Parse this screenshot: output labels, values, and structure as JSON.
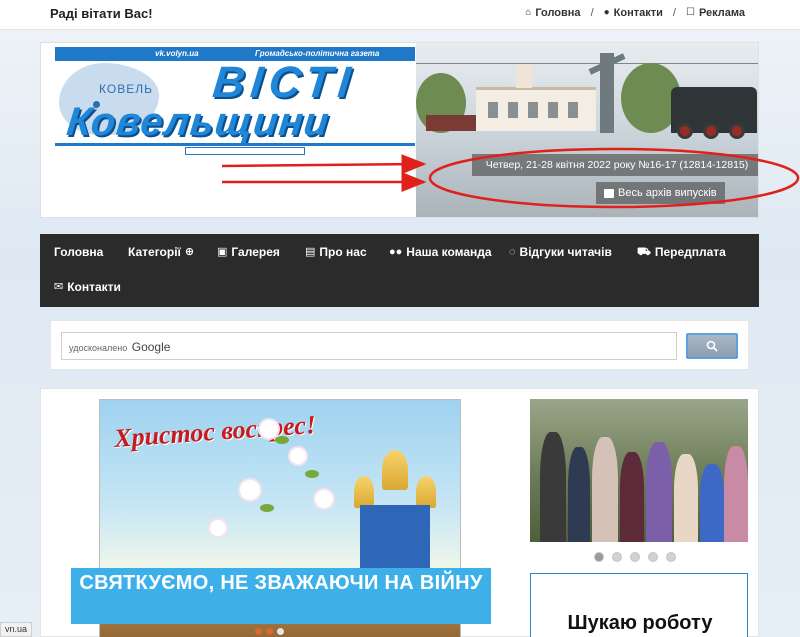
{
  "topbar": {
    "greeting": "Раді вітати Вас!",
    "links": [
      {
        "label": "Головна",
        "icon": "home-icon"
      },
      {
        "label": "Контакти",
        "icon": "chat-icon"
      },
      {
        "label": "Реклама",
        "icon": "edit-icon"
      }
    ],
    "separator": "/"
  },
  "header": {
    "logo": {
      "url_text": "vk.volyn.ua",
      "slogan": "Громадсько-політична  газета",
      "map_label": "КОВЕЛЬ",
      "title_line1": "ВІСТІ",
      "title_line2": "Ковельщини"
    },
    "issue_date": "Четвер, 21-28 квітня 2022 року №16-17 (12814-12815)",
    "archive_link": "Весь архів випусків",
    "annotation_color": "#e0201a"
  },
  "nav": {
    "items": [
      {
        "label": "Головна",
        "icon": ""
      },
      {
        "label": "Категорії",
        "icon": "circle-arrow-icon"
      },
      {
        "label": "Галерея",
        "icon": "image-icon"
      },
      {
        "label": "Про нас",
        "icon": "document-icon"
      },
      {
        "label": "Наша команда",
        "icon": "users-icon"
      },
      {
        "label": "Відгуки читачів",
        "icon": "comments-icon"
      },
      {
        "label": "Передплата",
        "icon": "cart-icon"
      },
      {
        "label": "Контакти",
        "icon": "envelope-icon"
      }
    ]
  },
  "search": {
    "hint_prefix": "удосконалено",
    "hint_brand": "Google",
    "button_icon": "search-icon"
  },
  "content": {
    "slide_text": "Христос воскрес!",
    "headline": "СВЯТКУЄМО, НЕ ЗВАЖАЮЧИ НА ВІЙНУ",
    "side_box_text": "Шукаю роботу",
    "slider_count": 5,
    "slider_active": 0
  },
  "status_url": "vn.ua",
  "colors": {
    "nav_bg": "#2b2b2b",
    "headline_bg": "#3db0e9",
    "brand_blue": "#1f86d8"
  }
}
